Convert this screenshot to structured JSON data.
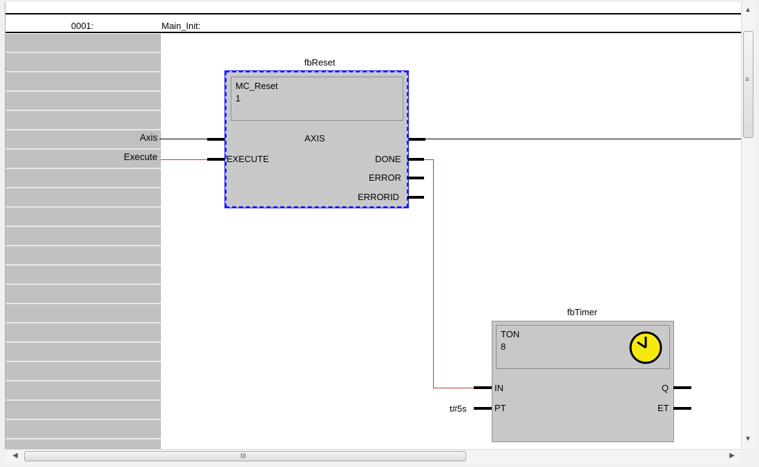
{
  "network": {
    "number": "0001:",
    "label": "Main_Init:"
  },
  "variables": {
    "axis": "Axis",
    "execute": "Execute"
  },
  "fb_reset": {
    "instance": "fbReset",
    "type": "MC_Reset",
    "index": "1",
    "inputs": {
      "axis": "AXIS",
      "execute": "EXECUTE"
    },
    "outputs": {
      "done": "DONE",
      "error": "ERROR",
      "errorid": "ERRORID"
    }
  },
  "fb_timer": {
    "instance": "fbTimer",
    "type": "TON",
    "index": "8",
    "inputs": {
      "in": "IN",
      "pt": "PT"
    },
    "outputs": {
      "q": "Q",
      "et": "ET"
    },
    "pt_value": "t#5s"
  },
  "scrollbars": {
    "grip_v": "≡",
    "grip_h": "III"
  },
  "colors": {
    "selection": "#1a1aff",
    "signal_wire": "#c0392b",
    "block_fill": "#c8c8c8",
    "clock_face": "#f5ea10"
  },
  "icons": {
    "timer": "clock-icon"
  }
}
